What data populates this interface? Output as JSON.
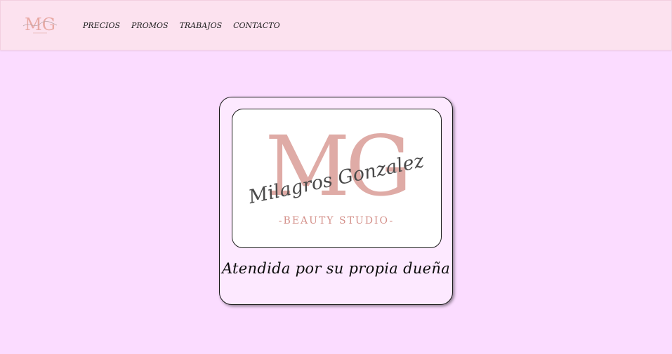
{
  "nav": {
    "logo_initials": "MG",
    "links": [
      {
        "label": "PRECIOS"
      },
      {
        "label": "PROMOS"
      },
      {
        "label": "TRABAJOS"
      },
      {
        "label": "CONTACTO"
      }
    ]
  },
  "hero": {
    "logo": {
      "initials": "MG",
      "script_name": "Milagros Gonzalez",
      "tagline": "-BEAUTY STUDIO-"
    },
    "caption": "Atendida por su propia dueña"
  },
  "colors": {
    "page_background": "#fbdcff",
    "header_background": "#fce2ef",
    "card_background": "#fde9ff",
    "logo_rose": "#c9736c",
    "script_gray": "#4a4a4a"
  }
}
